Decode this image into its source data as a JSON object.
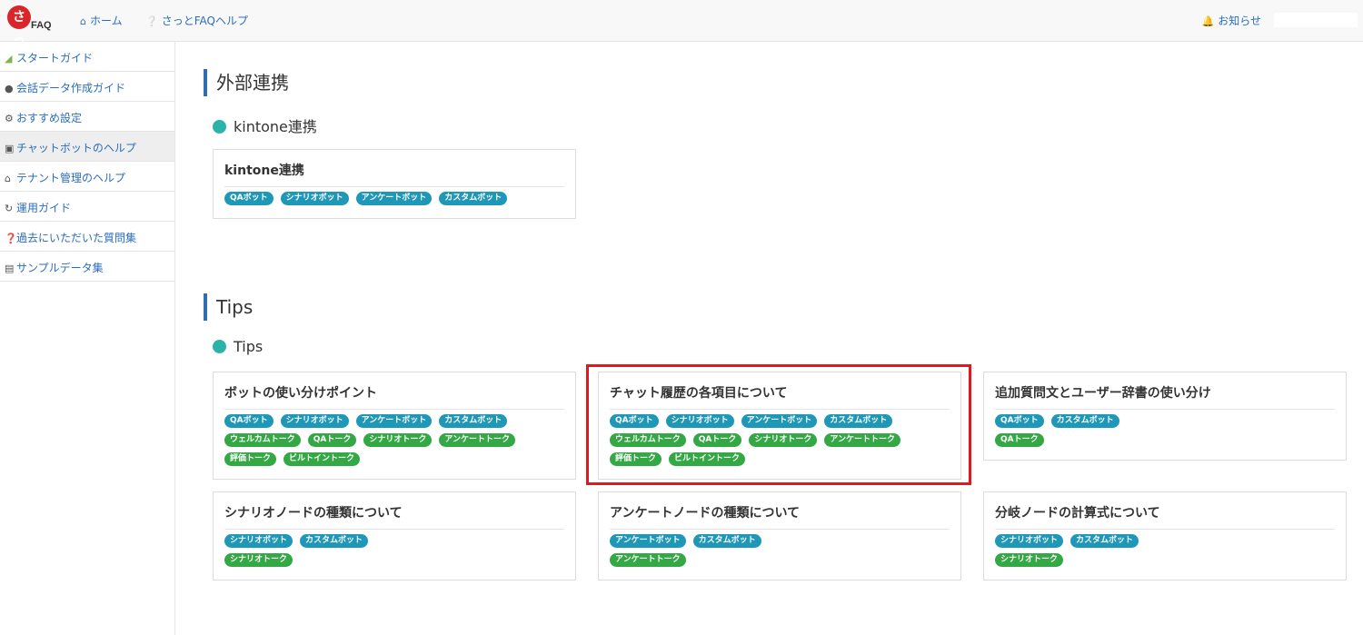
{
  "header": {
    "logo_text": "さっとFAQ",
    "logo_glyph": "さっ",
    "logo_sub": "FAQ",
    "home_label": "ホーム",
    "help_label": "さっとFAQヘルプ",
    "notice_label": "お知らせ",
    "colors": {
      "link": "#2a6ebb",
      "logo": "#d9262b"
    }
  },
  "sidebar": {
    "items": [
      {
        "label": "スタートガイド",
        "icon": "beginner-mark-icon"
      },
      {
        "label": "会話データ作成ガイド",
        "icon": "comments-icon"
      },
      {
        "label": "おすすめ設定",
        "icon": "gear-icon"
      },
      {
        "label": "チャットボットのヘルプ",
        "icon": "robot-icon",
        "active": true
      },
      {
        "label": "テナント管理のヘルプ",
        "icon": "home-icon"
      },
      {
        "label": "運用ガイド",
        "icon": "refresh-icon"
      },
      {
        "label": "過去にいただいた質問集",
        "icon": "question-circle-icon"
      },
      {
        "label": "サンプルデータ集",
        "icon": "file-icon"
      }
    ]
  },
  "sections": [
    {
      "title": "外部連携",
      "subsection": "kintone連携",
      "cards": [
        {
          "title": "kintone連携",
          "bot_tags": [
            "QAボット",
            "シナリオボット",
            "アンケートボット",
            "カスタムボット"
          ],
          "talk_tags": []
        }
      ]
    },
    {
      "title": "Tips",
      "subsection": "Tips",
      "cards": [
        {
          "title": "ボットの使い分けポイント",
          "bot_tags": [
            "QAボット",
            "シナリオボット",
            "アンケートボット",
            "カスタムボット"
          ],
          "talk_tags": [
            "ウェルカムトーク",
            "QAトーク",
            "シナリオトーク",
            "アンケートトーク",
            "評価トーク",
            "ビルトイントーク"
          ]
        },
        {
          "title": "チャット履歴の各項目について",
          "bot_tags": [
            "QAボット",
            "シナリオボット",
            "アンケートボット",
            "カスタムボット"
          ],
          "talk_tags": [
            "ウェルカムトーク",
            "QAトーク",
            "シナリオトーク",
            "アンケートトーク",
            "評価トーク",
            "ビルトイントーク"
          ],
          "highlighted": true
        },
        {
          "title": "追加質問文とユーザー辞書の使い分け",
          "bot_tags": [
            "QAボット",
            "カスタムボット"
          ],
          "talk_tags": [
            "QAトーク"
          ]
        },
        {
          "title": "シナリオノードの種類について",
          "bot_tags": [
            "シナリオボット",
            "カスタムボット"
          ],
          "talk_tags": [
            "シナリオトーク"
          ]
        },
        {
          "title": "アンケートノードの種類について",
          "bot_tags": [
            "アンケートボット",
            "カスタムボット"
          ],
          "talk_tags": [
            "アンケートトーク"
          ]
        },
        {
          "title": "分岐ノードの計算式について",
          "bot_tags": [
            "シナリオボット",
            "カスタムボット"
          ],
          "talk_tags": [
            "シナリオトーク"
          ]
        }
      ]
    }
  ],
  "colors": {
    "bot_tag": "#1f98b8",
    "talk_tag": "#33a844",
    "accent_bar": "#2f6fb0",
    "dot": "#2bb3a9",
    "highlight": "#e0191f"
  }
}
